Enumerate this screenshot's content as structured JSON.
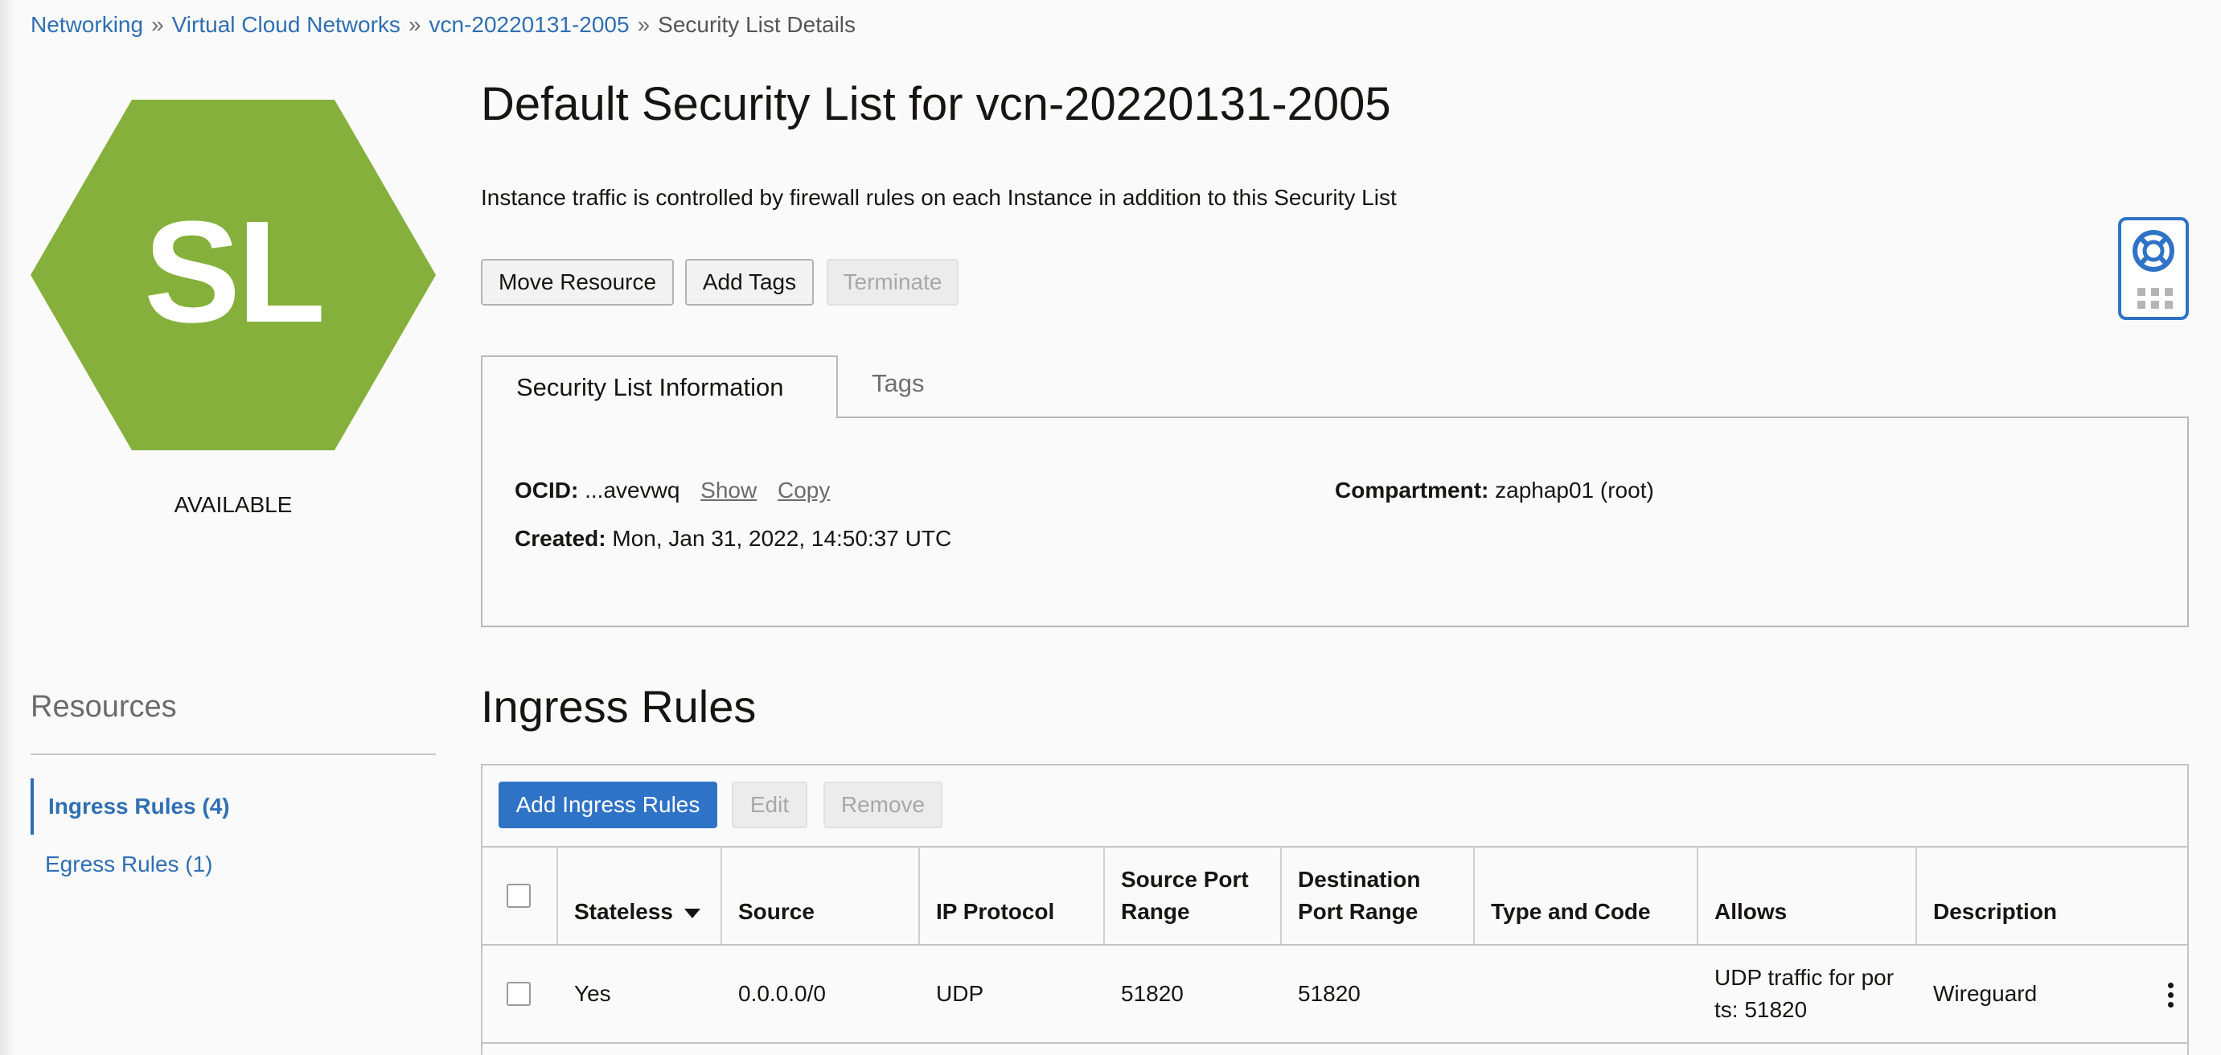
{
  "breadcrumb": {
    "items": [
      "Networking",
      "Virtual Cloud Networks",
      "vcn-20220131-2005"
    ],
    "current": "Security List Details",
    "separator": "»"
  },
  "resource_icon": {
    "initials": "SL",
    "color": "#86b03c"
  },
  "status": "AVAILABLE",
  "page": {
    "title": "Default Security List for vcn-20220131-2005",
    "description": "Instance traffic is controlled by firewall rules on each Instance in addition to this Security List"
  },
  "actions": {
    "move_resource": "Move Resource",
    "add_tags": "Add Tags",
    "terminate": "Terminate"
  },
  "tabs": {
    "info": "Security List Information",
    "tags": "Tags"
  },
  "info": {
    "ocid_label": "OCID:",
    "ocid_value": "...avevwq",
    "show": "Show",
    "copy": "Copy",
    "created_label": "Created:",
    "created_value": "Mon, Jan 31, 2022, 14:50:37 UTC",
    "compartment_label": "Compartment:",
    "compartment_value": "zaphap01 (root)"
  },
  "resources": {
    "title": "Resources",
    "items": [
      "Ingress Rules (4)",
      "Egress Rules (1)"
    ]
  },
  "ingress": {
    "title": "Ingress Rules",
    "add_button": "Add Ingress Rules",
    "edit_button": "Edit",
    "remove_button": "Remove",
    "columns": {
      "stateless": "Stateless",
      "source": "Source",
      "ip_protocol": "IP Protocol",
      "source_port_1": "Source Port",
      "source_port_2": "Range",
      "dest_port_1": "Destination",
      "dest_port_2": "Port Range",
      "type_code": "Type and Code",
      "allows": "Allows",
      "description": "Description"
    },
    "rows": [
      {
        "stateless": "Yes",
        "source": "0.0.0.0/0",
        "ip_protocol": "UDP",
        "source_port_range": "51820",
        "dest_port_range": "51820",
        "type_code": "",
        "allows_1": "UDP traffic for por",
        "allows_2": "ts: 51820",
        "description": "Wireguard"
      }
    ]
  },
  "colors": {
    "link": "#2f6fb3",
    "primary": "#2f73c7",
    "accent": "#86b03c"
  },
  "icons": [
    "sort-desc-icon",
    "lifebuoy-icon",
    "grid-dots-icon",
    "kebab-menu-icon"
  ]
}
